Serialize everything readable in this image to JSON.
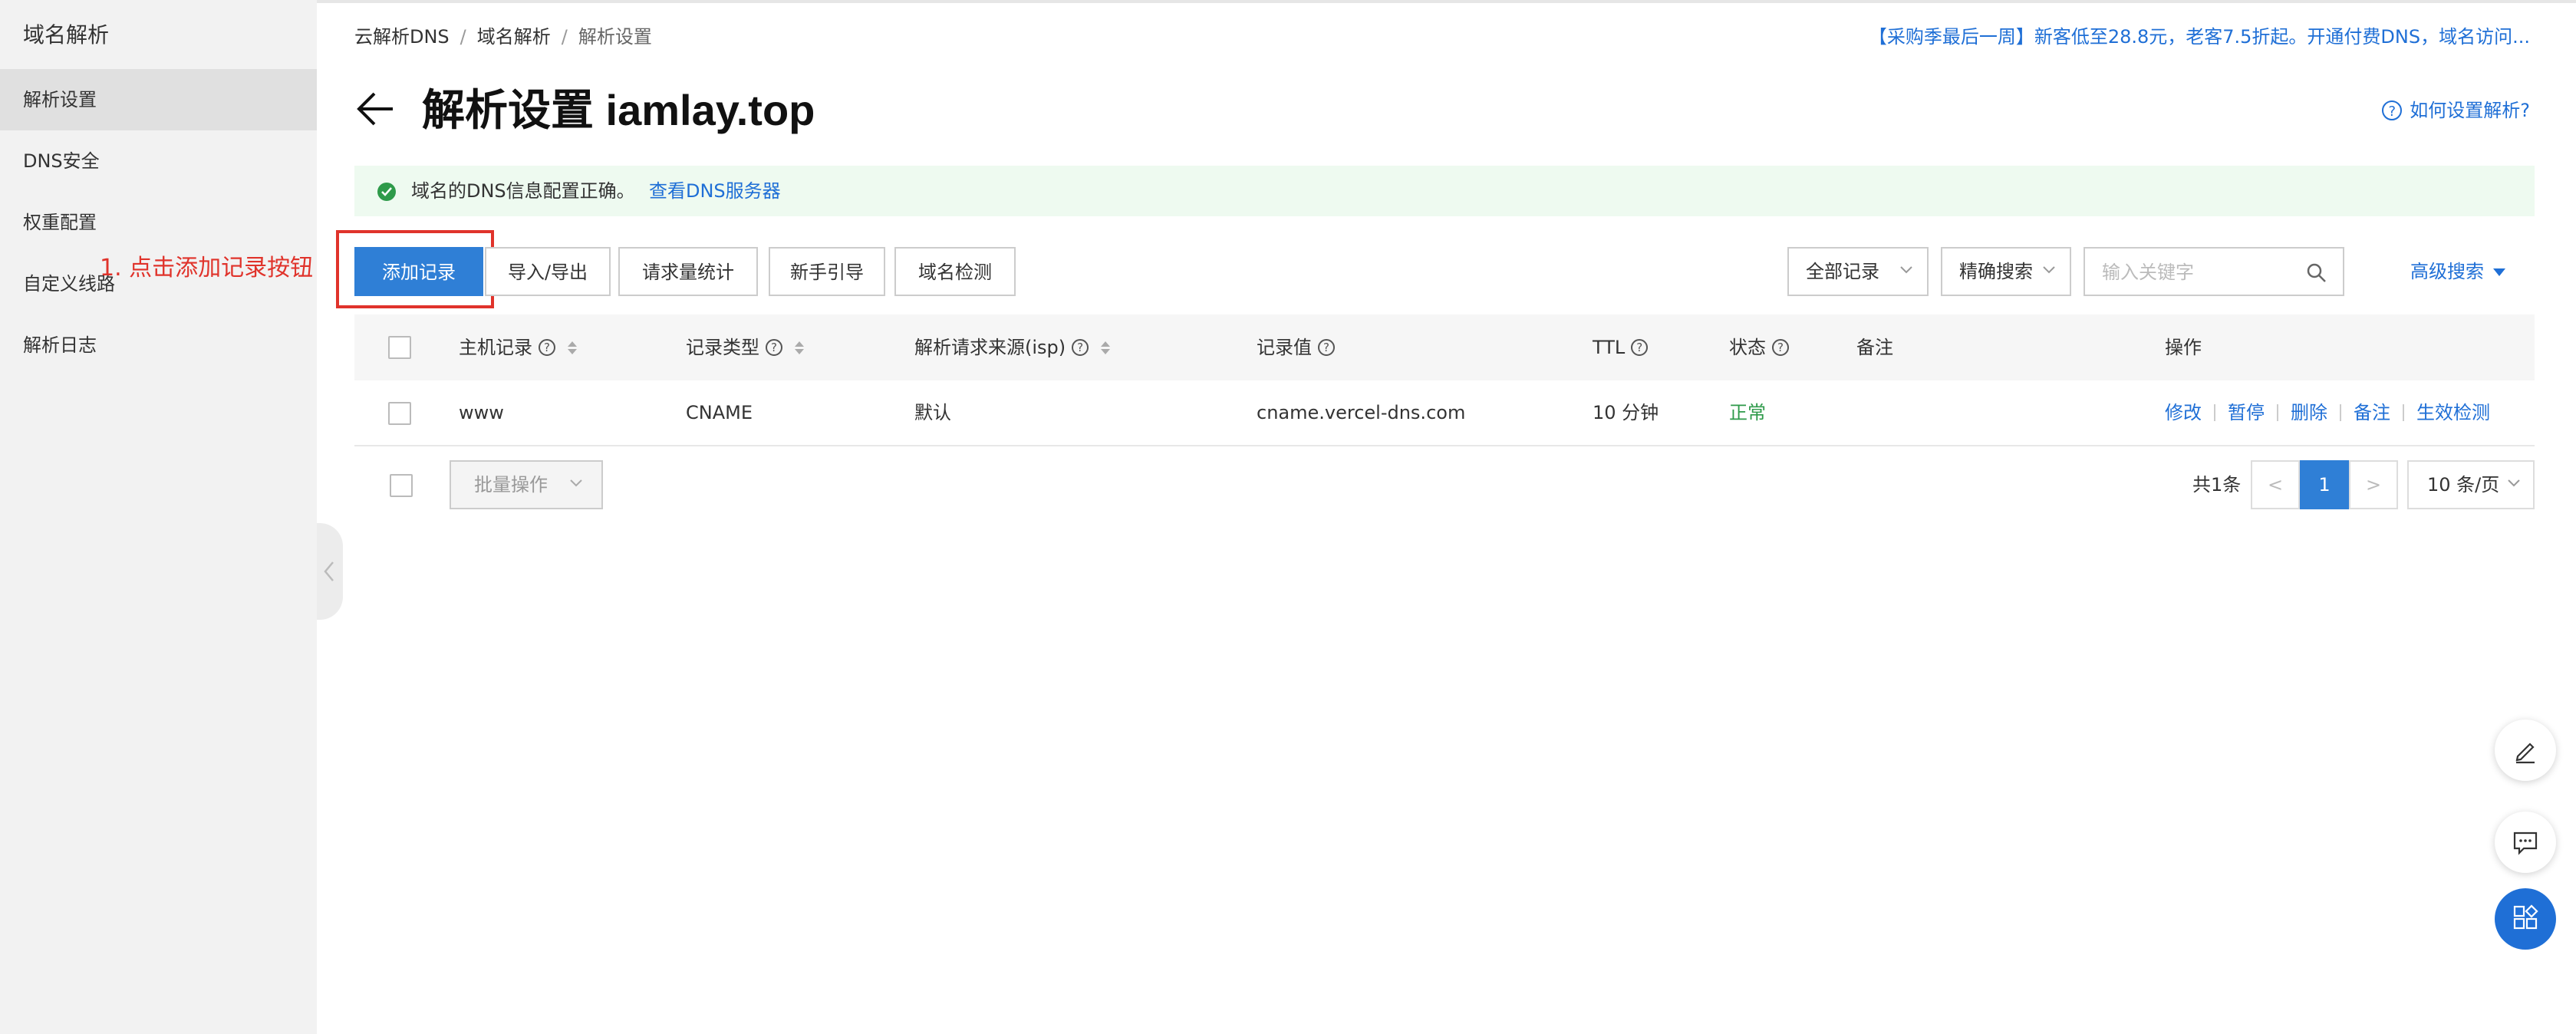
{
  "sidebar": {
    "title": "域名解析",
    "items": [
      {
        "label": "解析设置",
        "active": true
      },
      {
        "label": "DNS安全"
      },
      {
        "label": "权重配置"
      },
      {
        "label": "自定义线路"
      },
      {
        "label": "解析日志"
      }
    ]
  },
  "breadcrumb": [
    "云解析DNS",
    "域名解析",
    "解析设置"
  ],
  "breadcrumb_sep": "/",
  "promo": "【采购季最后一周】新客低至28.8元，老客7.5折起。开通付费DNS，域名访问...",
  "page_title": "解析设置 iamlay.top",
  "help_link": "如何设置解析?",
  "help_icon": "?",
  "notice": {
    "message": "域名的DNS信息配置正确。",
    "link": "查看DNS服务器"
  },
  "annotation": "1. 点击添加记录按钮",
  "toolbar": {
    "add": "添加记录",
    "import_export": "导入/导出",
    "request_stats": "请求量统计",
    "guide": "新手引导",
    "domain_check": "域名检测",
    "filter_all": "全部记录",
    "exact_search": "精确搜索",
    "search_placeholder": "输入关键字",
    "advanced": "高级搜索"
  },
  "table": {
    "columns": {
      "host": "主机记录",
      "type": "记录类型",
      "isp": "解析请求来源(isp)",
      "value": "记录值",
      "ttl": "TTL",
      "status": "状态",
      "remark": "备注",
      "ops": "操作"
    },
    "q": "?",
    "row": {
      "host": "www",
      "type": "CNAME",
      "isp": "默认",
      "value": "cname.vercel-dns.com",
      "ttl": "10 分钟",
      "status": "正常",
      "ops": [
        "修改",
        "暂停",
        "删除",
        "备注",
        "生效检测"
      ]
    }
  },
  "footer": {
    "batch": "批量操作",
    "total": "共1条",
    "prev": "<",
    "page": "1",
    "next": ">",
    "page_size": "10 条/页"
  },
  "colors": {
    "accent": "#2f7fd6",
    "link": "#1f6fd6",
    "success": "#2e9a4a",
    "annotation": "#e0332b"
  }
}
